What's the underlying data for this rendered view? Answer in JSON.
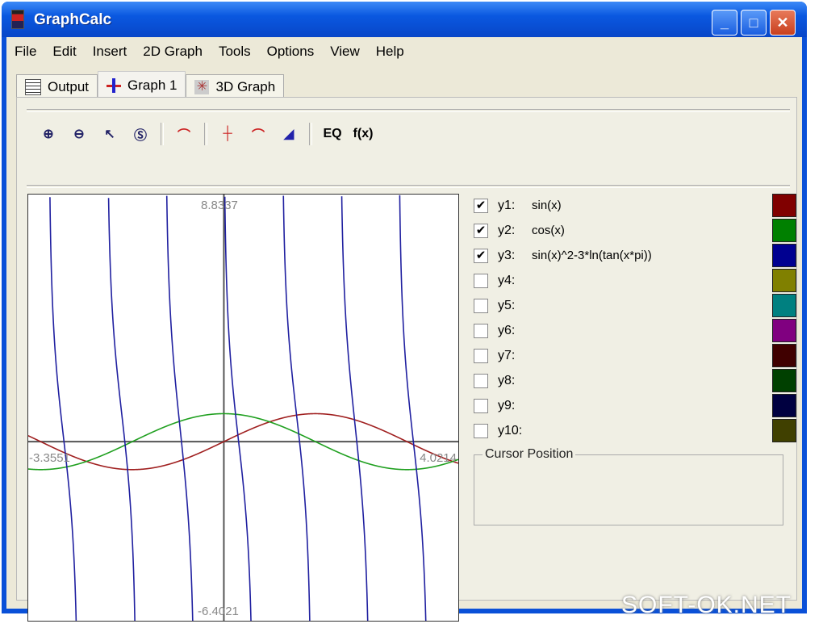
{
  "window": {
    "title": "GraphCalc",
    "controls": [
      "minimize",
      "maximize",
      "close"
    ]
  },
  "menu": [
    "File",
    "Edit",
    "Insert",
    "2D Graph",
    "Tools",
    "Options",
    "View",
    "Help"
  ],
  "tabs": [
    {
      "label": "Output",
      "active": false
    },
    {
      "label": "Graph 1",
      "active": true
    },
    {
      "label": "3D Graph",
      "active": false
    }
  ],
  "toolbar": {
    "items": [
      "zoom-in-icon",
      "zoom-out-icon",
      "zoom-back-icon",
      "zoom-standard-icon",
      "graph-view-icon",
      "trace-icon",
      "tangent-icon",
      "integral-icon"
    ],
    "eq_label": "EQ",
    "fx_label": "f(x)"
  },
  "graph": {
    "xmin": "-3.3551",
    "xmax": "4.0214",
    "ymax": "8.8337",
    "ymin": "-6.4021"
  },
  "functions": [
    {
      "label": "y1:",
      "expr": "sin(x)",
      "checked": true,
      "color": "#800000"
    },
    {
      "label": "y2:",
      "expr": "cos(x)",
      "checked": true,
      "color": "#008000"
    },
    {
      "label": "y3:",
      "expr": "sin(x)^2-3*ln(tan(x*pi))",
      "checked": true,
      "color": "#000090"
    },
    {
      "label": "y4:",
      "expr": "",
      "checked": false,
      "color": "#808000"
    },
    {
      "label": "y5:",
      "expr": "",
      "checked": false,
      "color": "#008080"
    },
    {
      "label": "y6:",
      "expr": "",
      "checked": false,
      "color": "#800080"
    },
    {
      "label": "y7:",
      "expr": "",
      "checked": false,
      "color": "#400000"
    },
    {
      "label": "y8:",
      "expr": "",
      "checked": false,
      "color": "#004000"
    },
    {
      "label": "y9:",
      "expr": "",
      "checked": false,
      "color": "#000040"
    },
    {
      "label": "y10:",
      "expr": "",
      "checked": false,
      "color": "#404000"
    }
  ],
  "cursor_position": {
    "title": "Cursor Position"
  },
  "watermark": "SOFT-OK.NET"
}
